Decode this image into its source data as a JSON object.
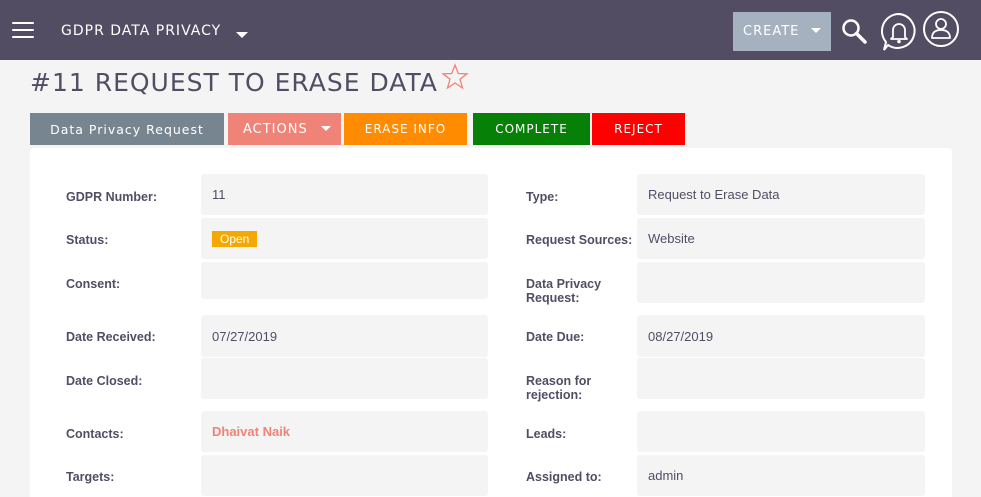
{
  "header": {
    "module": "GDPR DATA PRIVACY",
    "create_label": "CREATE"
  },
  "record": {
    "title": "#11 REQUEST TO ERASE DATA"
  },
  "tabs": {
    "data_privacy_request": "Data Privacy Request",
    "actions": "ACTIONS",
    "erase_info": "ERASE INFO",
    "complete": "COMPLETE",
    "reject": "REJECT"
  },
  "fields": {
    "gdpr_number": {
      "label": "GDPR Number:",
      "value": "11"
    },
    "type": {
      "label": "Type:",
      "value": "Request to Erase Data"
    },
    "status": {
      "label": "Status:",
      "value": "Open"
    },
    "request_sources": {
      "label": "Request Sources:",
      "value": "Website"
    },
    "consent": {
      "label": "Consent:",
      "value": ""
    },
    "data_privacy_request": {
      "label_line1": "Data Privacy",
      "label_line2": "Request:",
      "value": ""
    },
    "date_received": {
      "label": "Date Received:",
      "value": "07/27/2019"
    },
    "date_due": {
      "label": "Date Due:",
      "value": "08/27/2019"
    },
    "date_closed": {
      "label": "Date Closed:",
      "value": ""
    },
    "reason_for_rejection": {
      "label_line1": "Reason for",
      "label_line2": "rejection:",
      "value": ""
    },
    "contacts": {
      "label": "Contacts:",
      "value": "Dhaivat Naik"
    },
    "leads": {
      "label": "Leads:",
      "value": ""
    },
    "targets": {
      "label": "Targets:",
      "value": ""
    },
    "assigned_to": {
      "label": "Assigned to:",
      "value": "admin"
    }
  },
  "colors": {
    "topbar": "#534d64",
    "accent": "#f08377",
    "status_open": "#f5a800"
  }
}
